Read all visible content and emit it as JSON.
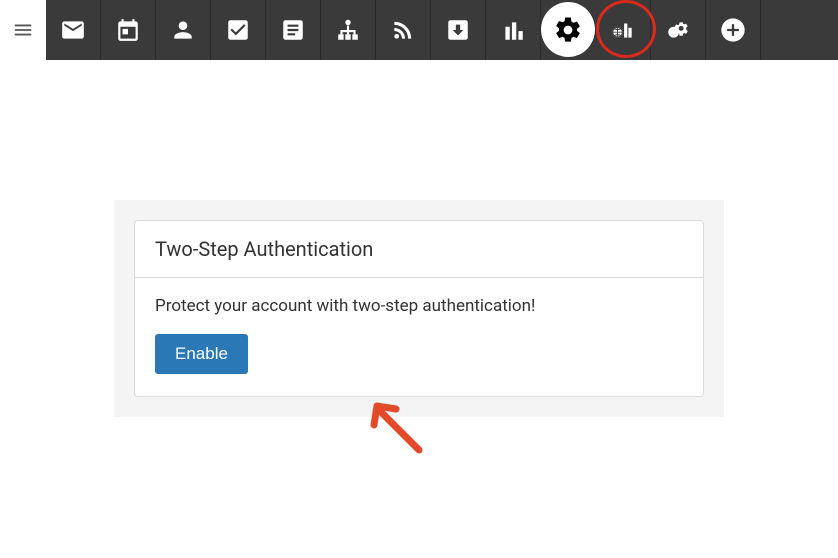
{
  "card": {
    "title": "Two-Step Authentication",
    "body_text": "Protect your account with two-step authentication!",
    "enable_label": "Enable"
  },
  "colors": {
    "toolbar_bg": "#3a3a3a",
    "primary_button": "#2b78b7",
    "annotation": "#e34a2a"
  }
}
